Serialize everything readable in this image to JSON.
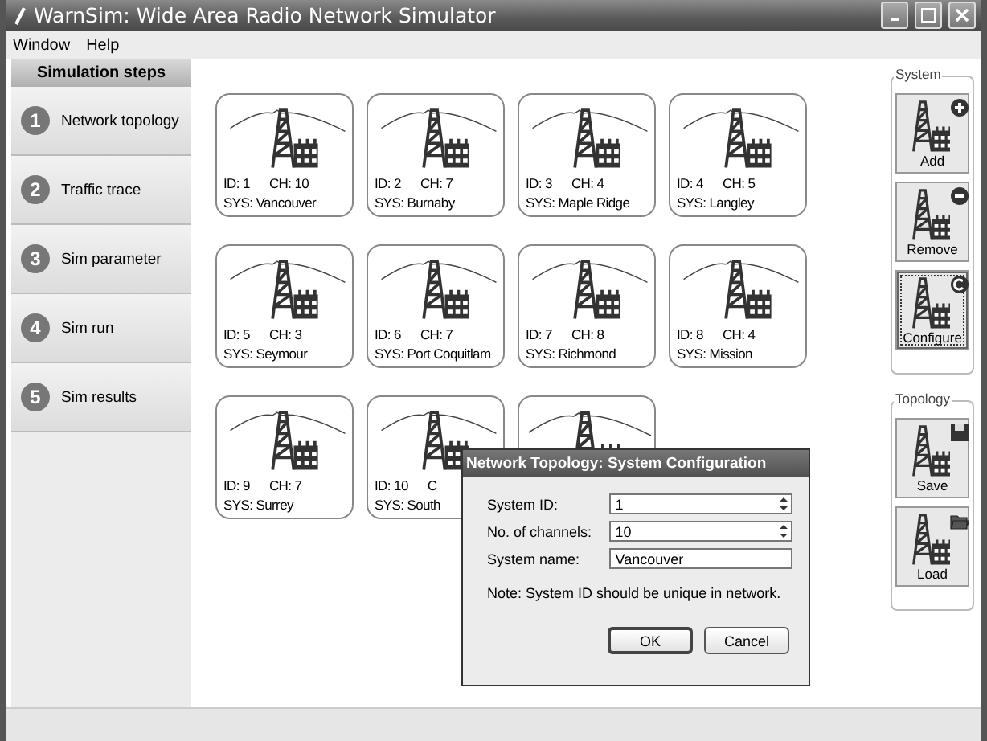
{
  "window": {
    "title": "WarnSim: Wide Area Radio Network Simulator"
  },
  "menu": [
    "Window",
    "Help"
  ],
  "sidebar": {
    "title": "Simulation steps",
    "steps": [
      {
        "number": "1",
        "label": "Network topology"
      },
      {
        "number": "2",
        "label": "Traffic trace"
      },
      {
        "number": "3",
        "label": "Sim parameter"
      },
      {
        "number": "4",
        "label": "Sim run"
      },
      {
        "number": "5",
        "label": "Sim results"
      }
    ]
  },
  "systems": [
    {
      "kind": "full",
      "id": "ID: 1",
      "ch": "CH: 10",
      "sys": "SYS: Vancouver"
    },
    {
      "kind": "full",
      "id": "ID: 2",
      "ch": "CH: 7",
      "sys": "SYS: Burnaby"
    },
    {
      "kind": "full",
      "id": "ID: 3",
      "ch": "CH: 4",
      "sys": "SYS: Maple Ridge"
    },
    {
      "kind": "full",
      "id": "ID: 4",
      "ch": "CH: 5",
      "sys": "SYS: Langley"
    },
    {
      "kind": "full",
      "id": "ID: 5",
      "ch": "CH: 3",
      "sys": "SYS: Seymour"
    },
    {
      "kind": "full",
      "id": "ID: 6",
      "ch": "CH: 7",
      "sys": "SYS: Port Coquitlam"
    },
    {
      "kind": "full",
      "id": "ID: 7",
      "ch": "CH: 8",
      "sys": "SYS: Richmond"
    },
    {
      "kind": "full",
      "id": "ID: 8",
      "ch": "CH: 4",
      "sys": "SYS: Mission"
    },
    {
      "kind": "full",
      "id": "ID: 9",
      "ch": "CH: 7",
      "sys": "SYS: Surrey"
    },
    {
      "kind": "full",
      "id": "ID: 10",
      "ch": "C",
      "sys": "SYS: South"
    },
    {
      "kind": "covered"
    }
  ],
  "panels": [
    {
      "title": "System",
      "buttons": [
        {
          "label": "Add",
          "kind": "plus",
          "focused": false
        },
        {
          "label": "Remove",
          "kind": "minus",
          "focused": false
        },
        {
          "label": "Configure",
          "kind": "gear",
          "focused": true
        }
      ]
    },
    {
      "title": "Topology",
      "buttons": [
        {
          "label": "Save",
          "kind": "disk",
          "focused": false
        },
        {
          "label": "Load",
          "kind": "folder",
          "focused": false
        }
      ]
    }
  ],
  "dialog": {
    "title": "Network Topology: System Configuration",
    "fields": [
      {
        "label": "System ID:",
        "value": "1",
        "kind": "spin"
      },
      {
        "label": "No. of channels:",
        "value": "10",
        "kind": "spin"
      },
      {
        "label": "System name:",
        "value": "Vancouver",
        "kind": "text"
      }
    ],
    "note": "Note: System ID should be unique in network.",
    "buttons": [
      {
        "label": "OK",
        "default": true
      },
      {
        "label": "Cancel",
        "default": false
      }
    ]
  }
}
